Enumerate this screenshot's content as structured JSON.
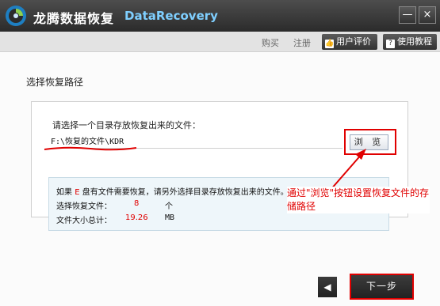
{
  "window": {
    "title": "龙腾数据恢复",
    "subtitle": "DataRecovery",
    "minimize_glyph": "—",
    "close_glyph": "×"
  },
  "toolbar": {
    "buy": "购买",
    "register": "注册",
    "review_label": "用户评价",
    "tutorial_label": "使用教程",
    "review_icon": "thumbs-up-icon",
    "tutorial_icon": "help-icon"
  },
  "main": {
    "section_title": "选择恢复路径",
    "prompt": "请选择一个目录存放恢复出来的文件：",
    "path_value": "F:\\恢复的文件\\KDR",
    "browse_label": "浏 览"
  },
  "info": {
    "line1_prefix": "如果",
    "line1_drive": "E",
    "line1_suffix": "盘有文件需要恢复，请另外选择目录存放恢复出来的文件。",
    "count_label": "选择恢复文件：",
    "count_value": "8",
    "count_unit": "个",
    "size_label": "文件大小总计：",
    "size_value": "19.26",
    "size_unit": "MB"
  },
  "annotation": {
    "callout_text": "通过\"浏览\"按钮设置恢复文件的存储路径",
    "color": "#e00000"
  },
  "footer": {
    "back_glyph": "◀",
    "next_label": "下一步"
  },
  "colors": {
    "titlebar": "#2b2b2b",
    "accent_text": "#7fcfff",
    "highlight": "#e00000"
  }
}
